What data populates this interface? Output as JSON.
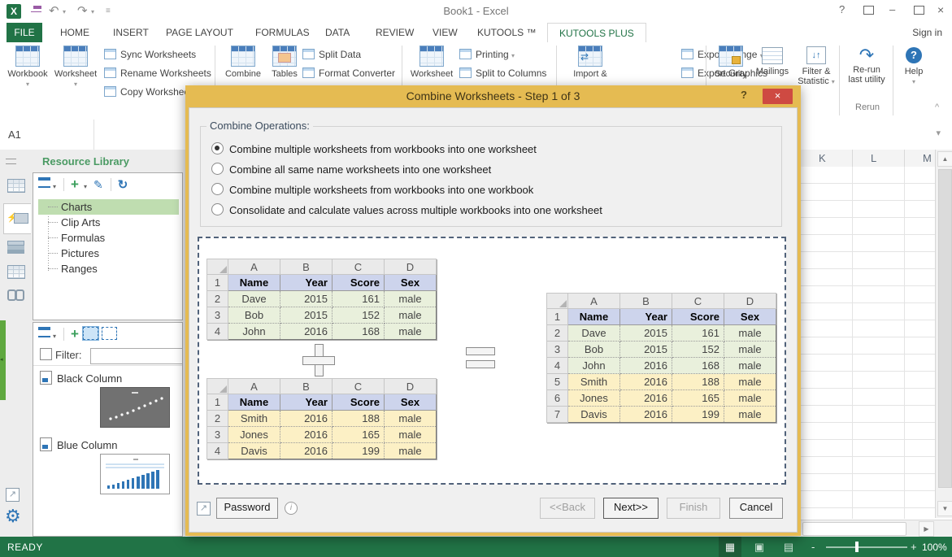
{
  "window": {
    "title": "Book1 - Excel",
    "sign_in": "Sign in",
    "help": "?"
  },
  "tabs": {
    "file": "FILE",
    "items": [
      "HOME",
      "INSERT",
      "PAGE LAYOUT",
      "FORMULAS",
      "DATA",
      "REVIEW",
      "VIEW",
      "KUTOOLS ™",
      "KUTOOLS PLUS"
    ],
    "active": "KUTOOLS PLUS"
  },
  "ribbon": {
    "workbook": "Workbook",
    "worksheet": "Worksheet",
    "sync": "Sync Worksheets",
    "rename": "Rename Worksheets",
    "copy": "Copy Worksheets",
    "combine": "Combine",
    "tables": "Tables",
    "split_data": "Split Data",
    "format_converter": "Format Converter",
    "worksheet2": "Worksheet",
    "printing": "Printing",
    "split_columns": "Split to Columns",
    "import_export": "Import &",
    "export_range": "Export Range",
    "export_graphics": "Export Graphics",
    "security": "Security",
    "mailings": "Mailings",
    "filter_line1": "Filter &",
    "filter_line2": "Statistic",
    "rerun_line1": "Re-run",
    "rerun_line2": "last utility",
    "rerun_group": "Rerun",
    "help": "Help"
  },
  "name_box": "A1",
  "sidebar": {
    "title": "Resource Library",
    "tree": [
      "Charts",
      "Clip Arts",
      "Formulas",
      "Pictures",
      "Ranges"
    ],
    "selected": "Charts",
    "filter_label": "Filter:",
    "filter_value": "",
    "items": [
      "Black Column",
      "Blue Column"
    ]
  },
  "dialog": {
    "title": "Combine Worksheets - Step 1 of 3",
    "help": "?",
    "group_label": "Combine Operations:",
    "options": [
      "Combine multiple worksheets from workbooks into one worksheet",
      "Combine all same name worksheets into one worksheet",
      "Combine multiple worksheets from workbooks into one workbook",
      "Consolidate and calculate values across multiple workbooks into one worksheet"
    ],
    "selected_option": 0,
    "password": "Password",
    "back": "<<Back",
    "next": "Next>>",
    "finish": "Finish",
    "cancel": "Cancel"
  },
  "sheet": {
    "columns": [
      "K",
      "L",
      "M"
    ]
  },
  "tables": {
    "top": {
      "columns": [
        "A",
        "B",
        "C",
        "D"
      ],
      "rows": [
        {
          "n": "1",
          "cls": "head",
          "cells": [
            "Name",
            "Year",
            "Score",
            "Sex"
          ]
        },
        {
          "n": "2",
          "cls": "green",
          "cells": [
            "Dave",
            "2015",
            "161",
            "male"
          ]
        },
        {
          "n": "3",
          "cls": "green",
          "cells": [
            "Bob",
            "2015",
            "152",
            "male"
          ]
        },
        {
          "n": "4",
          "cls": "green",
          "cells": [
            "John",
            "2016",
            "168",
            "male"
          ]
        }
      ]
    },
    "bottom": {
      "columns": [
        "A",
        "B",
        "C",
        "D"
      ],
      "rows": [
        {
          "n": "1",
          "cls": "head",
          "cells": [
            "Name",
            "Year",
            "Score",
            "Sex"
          ]
        },
        {
          "n": "2",
          "cls": "yellow",
          "cells": [
            "Smith",
            "2016",
            "188",
            "male"
          ]
        },
        {
          "n": "3",
          "cls": "yellow",
          "cells": [
            "Jones",
            "2016",
            "165",
            "male"
          ]
        },
        {
          "n": "4",
          "cls": "yellow",
          "cells": [
            "Davis",
            "2016",
            "199",
            "male"
          ]
        }
      ]
    },
    "result": {
      "columns": [
        "A",
        "B",
        "C",
        "D"
      ],
      "rows": [
        {
          "n": "1",
          "cls": "head",
          "cells": [
            "Name",
            "Year",
            "Score",
            "Sex"
          ]
        },
        {
          "n": "2",
          "cls": "green",
          "cells": [
            "Dave",
            "2015",
            "161",
            "male"
          ]
        },
        {
          "n": "3",
          "cls": "green",
          "cells": [
            "Bob",
            "2015",
            "152",
            "male"
          ]
        },
        {
          "n": "4",
          "cls": "green",
          "cells": [
            "John",
            "2016",
            "168",
            "male"
          ]
        },
        {
          "n": "5",
          "cls": "yellow",
          "cells": [
            "Smith",
            "2016",
            "188",
            "male"
          ]
        },
        {
          "n": "6",
          "cls": "yellow",
          "cells": [
            "Jones",
            "2016",
            "165",
            "male"
          ]
        },
        {
          "n": "7",
          "cls": "yellow",
          "cells": [
            "Davis",
            "2016",
            "199",
            "male"
          ]
        }
      ]
    }
  },
  "status": {
    "ready": "READY",
    "zoom": "100%",
    "minus": "-",
    "plus": "+"
  },
  "icons": {
    "undo": "↶",
    "redo": "↷",
    "dropdown": "▾",
    "up": "▲",
    "down": "▼",
    "right": "▶",
    "refresh": "↻",
    "edit": "✎",
    "add": "+",
    "gear": "⚙",
    "popout": "↗",
    "close": "×",
    "minimize": "–",
    "bolt": "⚡",
    "info": "i",
    "rerun": "↷",
    "stat": "↓↑",
    "collapse": "^",
    "chevron": "▾"
  },
  "colors": {
    "excel_green": "#217346",
    "dialog_gold": "#E5BB52",
    "close_red": "#CE4A42",
    "header_row": "#CDD4EC",
    "green_rows": "#E9F0DC",
    "yellow_rows": "#FCF0C5"
  }
}
